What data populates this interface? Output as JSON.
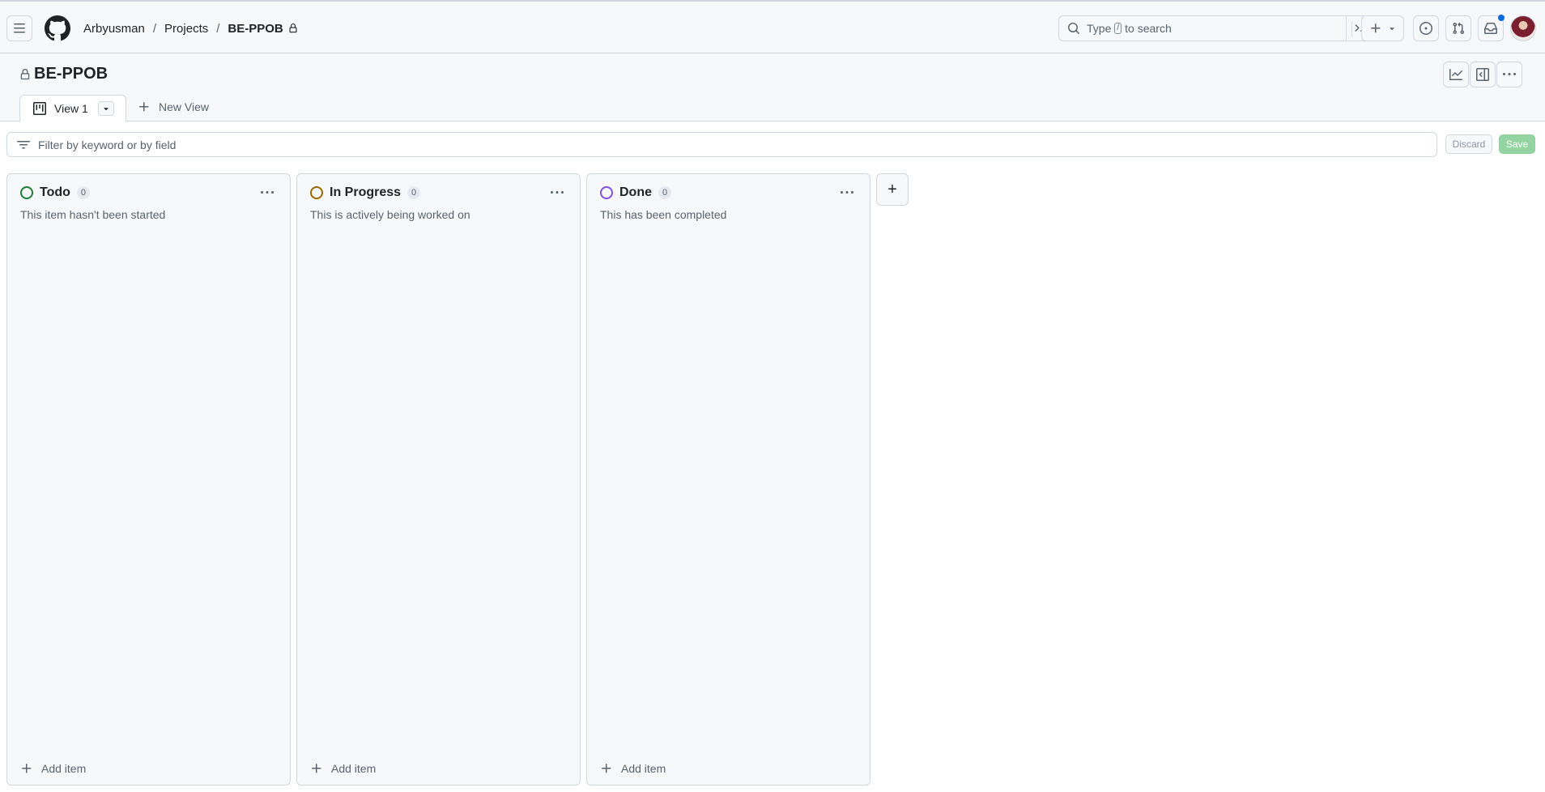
{
  "header": {
    "breadcrumb": {
      "owner": "Arbyusman",
      "section": "Projects",
      "project": "BE-PPOB",
      "separator": "/"
    },
    "search": {
      "prefix": "Type",
      "key": "/",
      "suffix": "to search"
    },
    "icons": {
      "menu": "hamburger-icon",
      "logo": "github-icon",
      "search": "search-icon",
      "command": "terminal-icon",
      "create": "plus-icon",
      "issues": "issue-opened-icon",
      "pull_requests": "git-pull-request-icon",
      "inbox": "inbox-icon"
    },
    "notification_color": "#0969da"
  },
  "project": {
    "title": "BE-PPOB",
    "views": [
      {
        "label": "View 1",
        "active": true
      }
    ],
    "new_view_label": "New View"
  },
  "filter": {
    "placeholder": "Filter by keyword or by field",
    "discard_label": "Discard",
    "save_label": "Save"
  },
  "columns": [
    {
      "name": "Todo",
      "count": "0",
      "description": "This item hasn't been started",
      "color": "#1a7f37",
      "add_label": "Add item"
    },
    {
      "name": "In Progress",
      "count": "0",
      "description": "This is actively being worked on",
      "color": "#9a6700",
      "add_label": "Add item"
    },
    {
      "name": "Done",
      "count": "0",
      "description": "This has been completed",
      "color": "#8250df",
      "add_label": "Add item"
    }
  ],
  "add_column_label": "+"
}
